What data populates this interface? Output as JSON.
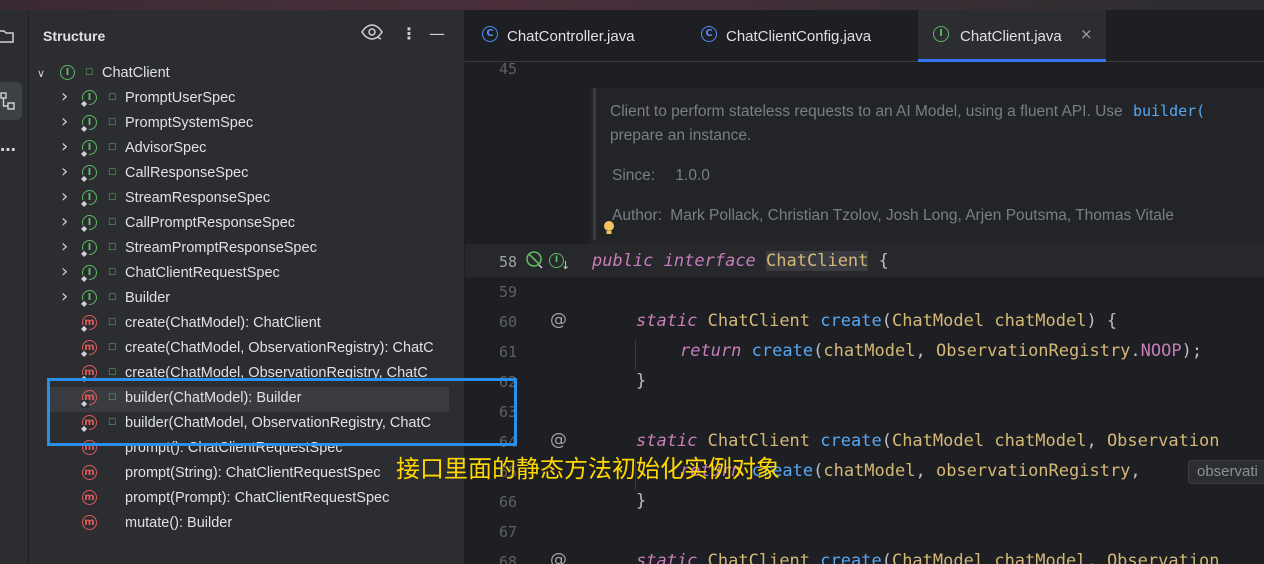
{
  "structure_panel": {
    "title": "Structure",
    "icons": [
      "eye-icon",
      "more-vertical-icon",
      "minimize-icon"
    ],
    "root": {
      "label": "ChatClient",
      "kind": "interface",
      "expanded": true
    },
    "items": [
      {
        "label": "PromptUserSpec",
        "kind": "interface",
        "expandable": true
      },
      {
        "label": "PromptSystemSpec",
        "kind": "interface",
        "expandable": true
      },
      {
        "label": "AdvisorSpec",
        "kind": "interface",
        "expandable": true
      },
      {
        "label": "CallResponseSpec",
        "kind": "interface",
        "expandable": true
      },
      {
        "label": "StreamResponseSpec",
        "kind": "interface",
        "expandable": true
      },
      {
        "label": "CallPromptResponseSpec",
        "kind": "interface",
        "expandable": true
      },
      {
        "label": "StreamPromptResponseSpec",
        "kind": "interface",
        "expandable": true
      },
      {
        "label": "ChatClientRequestSpec",
        "kind": "interface",
        "expandable": true
      },
      {
        "label": "Builder",
        "kind": "interface",
        "expandable": true
      },
      {
        "label": "create(ChatModel): ChatClient",
        "kind": "method",
        "static": true
      },
      {
        "label": "create(ChatModel, ObservationRegistry): ChatC",
        "kind": "method",
        "static": true
      },
      {
        "label": "create(ChatModel, ObservationRegistry, ChatC",
        "kind": "method",
        "static": true
      },
      {
        "label": "builder(ChatModel): Builder",
        "kind": "method",
        "static": true,
        "selected": true
      },
      {
        "label": "builder(ChatModel, ObservationRegistry, ChatC",
        "kind": "method",
        "static": true
      },
      {
        "label": "prompt(): ChatClientRequestSpec",
        "kind": "method"
      },
      {
        "label": "prompt(String): ChatClientRequestSpec",
        "kind": "method"
      },
      {
        "label": "prompt(Prompt): ChatClientRequestSpec",
        "kind": "method"
      },
      {
        "label": "mutate(): Builder",
        "kind": "method"
      }
    ]
  },
  "tabs": [
    {
      "label": "ChatController.java",
      "icon": "class-icon",
      "active": false
    },
    {
      "label": "ChatClientConfig.java",
      "icon": "class-icon",
      "active": false
    },
    {
      "label": "ChatClient.java",
      "icon": "interface-icon",
      "active": true,
      "close": "×"
    }
  ],
  "doc": {
    "line1": "Client to perform stateless requests to an AI Model, using a fluent API. Use",
    "line1_code": "builder(",
    "line2": "prepare an instance.",
    "since_label": "Since:",
    "since_value": "1.0.0",
    "author_label": "Author:",
    "author_value": "Mark Pollack, Christian Tzolov, Josh Long, Arjen Poutsma, Thomas Vitale"
  },
  "line_numbers": [
    "45",
    "58",
    "59",
    "60",
    "61",
    "62",
    "63",
    "64",
    "65",
    "66",
    "67",
    "68"
  ],
  "code": {
    "l58": {
      "kw1": "public",
      "kw2": "interface",
      "name": "ChatClient",
      "rest": " {"
    },
    "l60": {
      "kw": "static",
      "type": "ChatClient",
      "fn": "create",
      "p1": "(",
      "ptype": "ChatModel",
      "pname": "chatModel",
      "end": ") {"
    },
    "l61": {
      "kw": "return",
      "fn": "create",
      "a1": "(",
      "v1": "chatModel",
      "a2": ", ",
      "cls": "ObservationRegistry",
      "dot": ".",
      "cst": "NOOP",
      "end": ");"
    },
    "l62": "}",
    "l64": {
      "kw": "static",
      "type": "ChatClient",
      "fn": "create",
      "p1": "(",
      "ptype": "ChatModel",
      "pname": "chatModel",
      "sep": ", ",
      "ptype2": "Observation"
    },
    "l65": {
      "kw": "return",
      "fn": "create",
      "a1": "(",
      "v1": "chatModel",
      "a2": ", ",
      "v2": "observationRegistry",
      "a3": ",",
      "hint": "observati"
    },
    "l66": "}",
    "l68": {
      "kw": "static",
      "type": "ChatClient",
      "fn": "create",
      "p1": "(",
      "ptype": "ChatModel",
      "pname": "chatModel",
      "sep": ", ",
      "ptype2": "Observation"
    }
  },
  "annotation": {
    "text": "接口里面的静态方法初始化实例对象",
    "color": "#ffd700",
    "box_color": "#2a8fe8"
  },
  "gutter_marks": {
    "at_symbol": "@"
  }
}
